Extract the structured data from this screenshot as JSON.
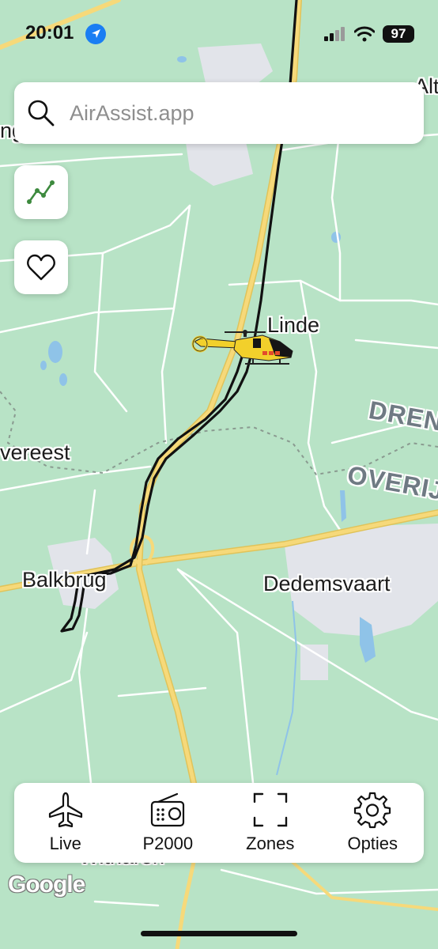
{
  "status_bar": {
    "time": "20:01",
    "battery": "97",
    "icons": [
      "location-arrow-icon",
      "cellular-signal-icon",
      "wifi-icon",
      "battery-icon"
    ]
  },
  "search": {
    "placeholder": "AirAssist.app",
    "icon": "search-icon"
  },
  "side_buttons": [
    {
      "icon": "track-history-icon"
    },
    {
      "icon": "heart-icon"
    }
  ],
  "map": {
    "places": [
      "Linde",
      "Balkbrug",
      "Dedemsvaart",
      "vereest",
      "Witharen",
      "Alt",
      "ng"
    ],
    "regions": [
      "DREN",
      "OVERIJ"
    ],
    "tracked_aircraft": "helicopter-icon",
    "attribution": "Google",
    "colors": {
      "land": "#b8e3c6",
      "highway": "#f2d36b",
      "road": "#ffffff",
      "water": "#8fc3e8",
      "urban": "#e5e6ea",
      "flight_track": "#111111",
      "helicopter": "#f2d02b"
    }
  },
  "nav": [
    {
      "label": "Live",
      "icon": "airplane-icon"
    },
    {
      "label": "P2000",
      "icon": "radio-icon"
    },
    {
      "label": "Zones",
      "icon": "zones-frame-icon"
    },
    {
      "label": "Opties",
      "icon": "gear-icon"
    }
  ]
}
